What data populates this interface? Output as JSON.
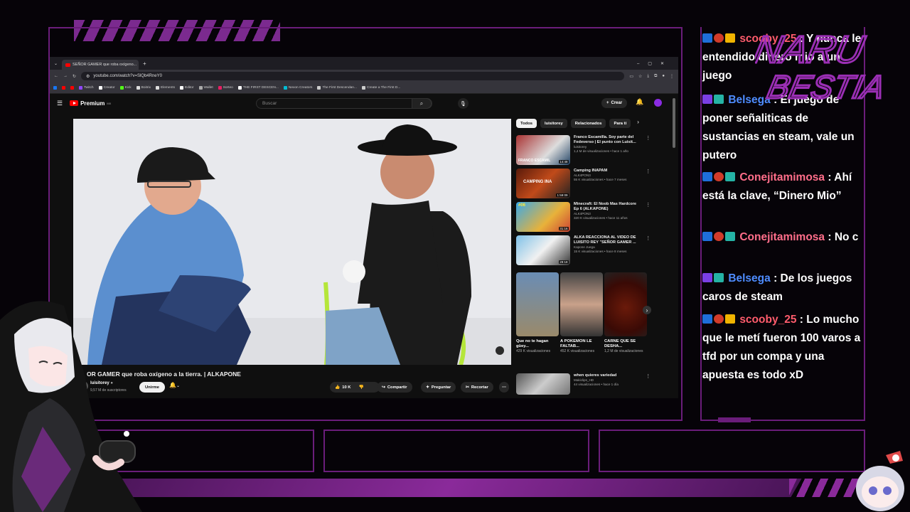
{
  "browser": {
    "tab_title": "SEÑOR GAMER que roba oxígeno...",
    "url": "youtube.com/watch?v=SlQb4RneY0",
    "bookmarks": [
      "Twitch",
      "Creator",
      "Kick",
      "Boitrix",
      "Elements",
      "Editor",
      "Wallet",
      "Sorteo",
      "THE FIRST DESCEN...",
      "Nexon Creators",
      "The First Descendan...",
      "Create a The First D..."
    ]
  },
  "youtube": {
    "logo": "Premium",
    "logo_region": "MX",
    "search_placeholder": "Buscar",
    "create_label": "Crear",
    "video_title": "OR GAMER que roba oxígeno a la tierra. | ALKAPONE",
    "channel": "luisitorey",
    "subscribers": "9,57 M de suscriptores",
    "subscribe_label": "Unirme",
    "likes": "10 K",
    "actions": [
      "Compartir",
      "Preguntar",
      "Recortar"
    ],
    "chips": [
      "Todos",
      "luisitorey",
      "Relacionados",
      "Para ti"
    ],
    "recommendations": [
      {
        "title": "Franco Escamilla. Soy parte del Fedeverso | El punto con Luisit...",
        "channel": "luisitorey",
        "meta": "1,4 M de visualizaciones • hace 1 año",
        "duration": "14:48",
        "thumb_text": "FRANCO ESCAMIL"
      },
      {
        "title": "Camping INAPAM",
        "channel": "ALK4PON3",
        "meta": "55 K visualizaciones • hace 7 meses",
        "duration": "1:59:09",
        "thumb_text": "CAMPING INA"
      },
      {
        "title": "Minecraft: El Noob Mas Hardcore Ep 6 (ALKAPONE)",
        "channel": "ALK4PON3",
        "meta": "320 K visualizaciones • hace 11 años",
        "duration": "31:16",
        "thumb_text": "#06"
      },
      {
        "title": "ALKA REACCIONA AL VIDEO DE LUISITO REY \"SEÑOR GAMER ...",
        "channel": "Kapone Juega",
        "meta": "15 K visualizaciones • hace 8 meses",
        "duration": "29:18",
        "thumb_text": ""
      }
    ],
    "shorts": [
      {
        "title": "Que no te hagan güey...",
        "views": "429 K visualizaciones"
      },
      {
        "title": "A POKEMON LE FALTAB...",
        "views": "452 K visualizaciones"
      },
      {
        "title": "CARNE QUE SE DESHA...",
        "views": "1,2 M de visualizaciones"
      }
    ],
    "next_rec": {
      "title": "when quieres variedad",
      "channel": "Makiclips_HD",
      "meta": "44 visualizaciones • hace 1 día"
    }
  },
  "chat": {
    "logo_line1": "NARU",
    "logo_line2": "BESTIA",
    "messages": [
      {
        "user": "scooby_25",
        "text": "Y nunca le entendido dinero mio a un juego",
        "color": "#ff5c6c"
      },
      {
        "user": "Belsega",
        "text": "El juego de poner señaliticas de sustancias en steam, vale un putero",
        "color": "#4e8cff"
      },
      {
        "user": "Conejitamimosa",
        "text": "Ahí está la clave, “Dinero Mio”",
        "color": "#ff6e8a"
      },
      {
        "user": "Conejitamimosa",
        "text": "No c",
        "color": "#ff6e8a"
      },
      {
        "user": "Belsega",
        "text": "De los juegos caros de steam",
        "color": "#4e8cff"
      },
      {
        "user": "scooby_25",
        "text": "Lo mucho que le metí fueron 100 varos a tfd por un compa y una apuesta es todo xD",
        "color": "#ff5c6c"
      }
    ]
  },
  "theme": {
    "frame": "#6a1d7a",
    "accent": "#8a2a9a"
  }
}
